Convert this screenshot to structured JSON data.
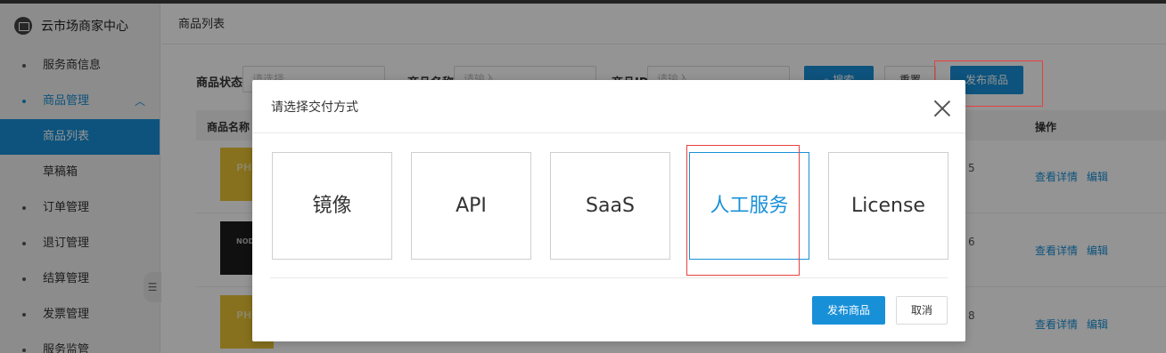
{
  "sidebar": {
    "brand": "云市场商家中心",
    "items": [
      {
        "label": "服务商信息"
      },
      {
        "label": "商品管理",
        "caret": "︿"
      },
      {
        "label": "商品列表"
      },
      {
        "label": "草稿箱"
      },
      {
        "label": "订单管理"
      },
      {
        "label": "退订管理"
      },
      {
        "label": "结算管理"
      },
      {
        "label": "发票管理"
      },
      {
        "label": "服务监管"
      }
    ],
    "collapse_icon": "☰"
  },
  "main": {
    "page_title": "商品列表",
    "filters": {
      "status_label": "商品状态",
      "status_placeholder": "请选择",
      "name_label": "商品名称",
      "name_placeholder": "请输入",
      "id_label": "商品ID",
      "id_placeholder": "请输入"
    },
    "buttons": {
      "search": "搜索",
      "reset": "重置",
      "publish": "发布商品"
    },
    "table": {
      "headers": [
        "商品名称",
        "操作"
      ],
      "rows": [
        {
          "thumb_text": "PH JAV",
          "num": "5",
          "view": "查看详情",
          "edit": "编辑"
        },
        {
          "thumb_text": "NOD",
          "num": "6",
          "view": "查看详情",
          "edit": "编辑"
        },
        {
          "thumb_text": "PH JAV",
          "num": "8",
          "view": "查看详情",
          "edit": "编辑"
        }
      ]
    }
  },
  "modal": {
    "title": "请选择交付方式",
    "options": [
      "镜像",
      "API",
      "SaaS",
      "人工服务",
      "License"
    ],
    "selected_option": "人工服务",
    "confirm": "发布商品",
    "cancel": "取消"
  },
  "colors": {
    "accent": "#1890d8",
    "highlight": "#e8403f"
  }
}
